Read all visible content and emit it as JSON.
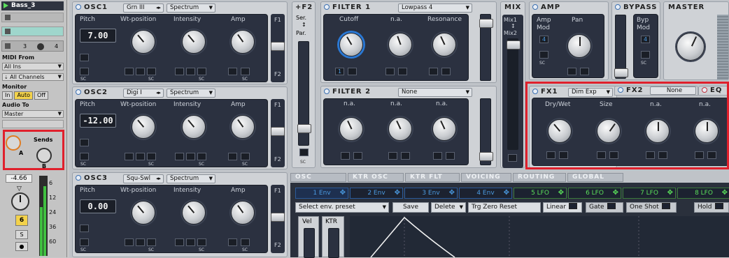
{
  "ableton": {
    "track_name": "Bass_3",
    "midi_from_label": "MIDI From",
    "midi_from_value": "All Ins",
    "midi_channel": "All Channels",
    "monitor_label": "Monitor",
    "monitor_in": "In",
    "monitor_auto": "Auto",
    "monitor_off": "Off",
    "audio_to_label": "Audio To",
    "audio_to_value": "Master",
    "sends_label": "Sends",
    "send_a": "A",
    "send_b": "B",
    "num_3": "3",
    "num_4": "4",
    "volume": "-4.66",
    "track_number": "6",
    "solo": "S",
    "meter_ticks": [
      "6",
      "12",
      "24",
      "36",
      "60"
    ]
  },
  "osc": [
    {
      "title": "OSC1",
      "wave": "Grn III",
      "mode": "Spectrum",
      "pitch": "7.00",
      "knobs": [
        "Pitch",
        "Wt-position",
        "Intensity",
        "Amp"
      ]
    },
    {
      "title": "OSC2",
      "wave": "Digi I",
      "mode": "Spectrum",
      "pitch": "-12.00",
      "knobs": [
        "Pitch",
        "Wt-position",
        "Intensity",
        "Amp"
      ]
    },
    {
      "title": "OSC3",
      "wave": "Squ-Swl",
      "mode": "Spectrum",
      "pitch": "0.00",
      "knobs": [
        "Pitch",
        "Wt-position",
        "Intensity",
        "Amp"
      ]
    }
  ],
  "f2": {
    "title": "F2",
    "sub1": "Ser.",
    "sub2": "Par.",
    "side1": "F1",
    "side2": "F2"
  },
  "filter1": {
    "title": "FILTER 1",
    "type": "Lowpass 4",
    "knobs": [
      "Cutoff",
      "n.a.",
      "Resonance"
    ],
    "env": "1"
  },
  "filter2": {
    "title": "FILTER 2",
    "type": "None",
    "knobs": [
      "n.a.",
      "n.a.",
      "n.a."
    ]
  },
  "mix": {
    "title": "MIX",
    "l1": "Mix1",
    "l2": "Mix2"
  },
  "amp": {
    "title": "AMP",
    "k1a": "Amp",
    "k1b": "Mod",
    "k2": "Pan",
    "val": "4"
  },
  "bypass": {
    "title": "BYPASS",
    "k1a": "Byp",
    "k1b": "Mod",
    "val": "4"
  },
  "master": {
    "title": "MASTER"
  },
  "fx1": {
    "title": "FX1",
    "type": "Dim Exp",
    "knobs": [
      "Dry/Wet",
      "Size",
      "n.a.",
      "n.a."
    ]
  },
  "fx2": {
    "title": "FX2",
    "type": "None"
  },
  "eq": {
    "title": "EQ"
  },
  "tabs": [
    "OSC",
    "KTR OSC",
    "KTR FLT",
    "VOICING",
    "ROUTING",
    "GLOBAL"
  ],
  "envs": [
    "1 Env",
    "2 Env",
    "3 Env",
    "4 Env",
    "5 LFO",
    "6 LFO",
    "7 LFO",
    "8 LFO"
  ],
  "toolbar": {
    "preset": "Select env. preset",
    "save": "Save",
    "delete": "Delete",
    "trg": "Trg Zero Reset",
    "linear": "Linear",
    "gate": "Gate",
    "oneshot": "One Shot",
    "hold": "Hold"
  },
  "env_side": {
    "vel": "Vel",
    "ktr": "KTR"
  },
  "sc": "SC"
}
